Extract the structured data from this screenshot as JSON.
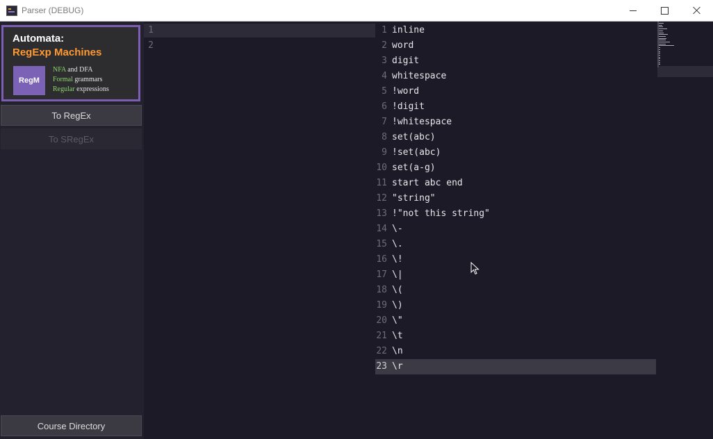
{
  "window": {
    "title": "Parser (DEBUG)"
  },
  "sidebar": {
    "banner": {
      "line1": "Automata:",
      "line2": "RegExp Machines",
      "logo": "RegM",
      "points": [
        {
          "hl": "NFA",
          "rest": " and DFA"
        },
        {
          "hl": "Formal",
          "rest": " grammars"
        },
        {
          "hl": "Regular",
          "rest": " expressions"
        }
      ]
    },
    "to_regex": "To RegEx",
    "to_sregex": "To SRegEx",
    "course_directory": "Course Directory"
  },
  "left_editor": {
    "line_numbers": [
      "1",
      "2"
    ]
  },
  "right_editor": {
    "lines": [
      {
        "n": "1",
        "text": "inline"
      },
      {
        "n": "2",
        "text": "word"
      },
      {
        "n": "3",
        "text": "digit"
      },
      {
        "n": "4",
        "text": "whitespace"
      },
      {
        "n": "5",
        "text": "!word"
      },
      {
        "n": "6",
        "text": "!digit"
      },
      {
        "n": "7",
        "text": "!whitespace"
      },
      {
        "n": "8",
        "text": "set(abc)"
      },
      {
        "n": "9",
        "text": "!set(abc)"
      },
      {
        "n": "10",
        "text": "set(a-g)"
      },
      {
        "n": "11",
        "text": "start abc end"
      },
      {
        "n": "12",
        "text": "\"string\""
      },
      {
        "n": "13",
        "text": "!\"not this string\""
      },
      {
        "n": "14",
        "text": "\\-"
      },
      {
        "n": "15",
        "text": "\\."
      },
      {
        "n": "16",
        "text": "\\!"
      },
      {
        "n": "17",
        "text": "\\|"
      },
      {
        "n": "18",
        "text": "\\("
      },
      {
        "n": "19",
        "text": "\\)"
      },
      {
        "n": "20",
        "text": "\\\""
      },
      {
        "n": "21",
        "text": "\\t"
      },
      {
        "n": "22",
        "text": "\\n"
      },
      {
        "n": "23",
        "text": "\\r"
      }
    ],
    "current_line": "23"
  },
  "colors": {
    "background": "#1c1a27",
    "sidebar": "#23212d",
    "accent_purple": "#7c5fb2",
    "accent_orange": "#ff9933",
    "highlight_green": "#8cd36e"
  }
}
